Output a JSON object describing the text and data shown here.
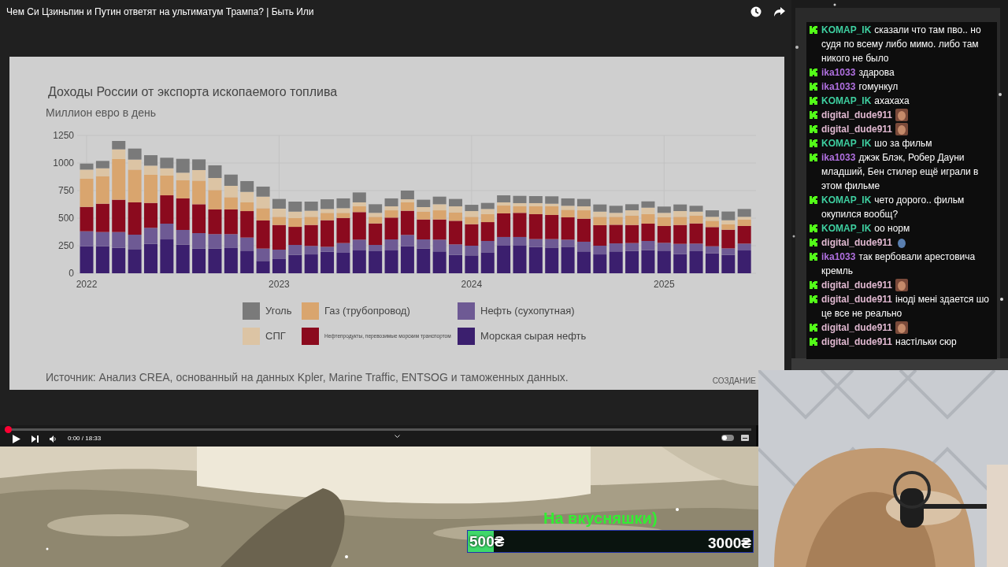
{
  "video": {
    "title": "Чем Си Цзиньпин и Путин ответят на ультиматум Трампа? | Быть Или",
    "slide": {
      "chart_data": {
        "type": "bar",
        "stacked": true,
        "grid": true,
        "title": "Доходы России от экспорта ископаемого топлива",
        "ylabel": "Миллион евро в день",
        "categories": [
          "2022",
          null,
          null,
          null,
          null,
          null,
          null,
          null,
          null,
          null,
          null,
          null,
          "2023",
          null,
          null,
          null,
          null,
          null,
          null,
          null,
          null,
          null,
          null,
          null,
          "2024",
          null,
          null,
          null,
          null,
          null,
          null,
          null,
          null,
          null,
          null,
          null,
          "2025",
          null,
          null,
          null,
          null,
          null
        ],
        "ylim": [
          0,
          1250
        ],
        "yticks": [
          0,
          250,
          500,
          750,
          1000,
          1250
        ],
        "series": [
          {
            "name": "Морская сырая нефть",
            "color": "#3b1f6e",
            "values": [
              245,
              245,
              231,
              219,
              267,
              307,
              260,
              224,
              224,
              229,
              205,
              112,
              129,
              167,
              171,
              195,
              186,
              207,
              200,
              207,
              245,
              224,
              198,
              167,
              162,
              190,
              250,
              250,
              238,
              233,
              240,
              198,
              171,
              198,
              202,
              210,
              205,
              174,
              200,
              181,
              167,
              207
            ]
          },
          {
            "name": "Нефть (сухопутная)",
            "color": "#6e5a94",
            "values": [
              136,
              129,
              143,
              131,
              145,
              143,
              133,
              140,
              131,
              126,
              119,
              112,
              85,
              90,
              77,
              45,
              88,
              98,
              57,
              100,
              103,
              83,
              107,
              95,
              88,
              103,
              79,
              79,
              72,
              77,
              65,
              88,
              79,
              73,
              72,
              83,
              71,
              93,
              69,
              64,
              59,
              62
            ]
          },
          {
            "name": "Нефтепродукты, перевозимые морским транспортом",
            "color": "#8b0a1e",
            "values": [
              221,
              257,
              293,
              293,
              226,
              257,
              286,
              262,
              224,
              224,
              240,
              255,
              224,
              164,
              190,
              241,
              228,
              250,
              195,
              198,
              219,
              181,
              183,
              214,
              195,
              171,
              214,
              219,
              226,
              219,
              202,
              209,
              186,
              169,
              164,
              157,
              153,
              171,
              183,
              174,
              169,
              160
            ]
          },
          {
            "name": "Газ (трубопровод)",
            "color": "#d9a56e",
            "values": [
              255,
              250,
              369,
              297,
              255,
              179,
              166,
              214,
              176,
              111,
              79,
              111,
              74,
              79,
              74,
              67,
              46,
              52,
              60,
              66,
              76,
              72,
              83,
              76,
              67,
              72,
              71,
              59,
              71,
              78,
              69,
              76,
              76,
              72,
              86,
              86,
              78,
              74,
              72,
              57,
              48,
              59
            ]
          },
          {
            "name": "СПГ",
            "color": "#dcc4a4",
            "values": [
              83,
              71,
              88,
              91,
              83,
              66,
              67,
              96,
              109,
              103,
              95,
              105,
              74,
              59,
              55,
              35,
              42,
              36,
              36,
              36,
              28,
              40,
              55,
              55,
              52,
              47,
              29,
              29,
              29,
              24,
              36,
              36,
              47,
              36,
              47,
              59,
              41,
              52,
              35,
              36,
              38,
              24
            ]
          },
          {
            "name": "Уголь",
            "color": "#7a7a7a",
            "values": [
              55,
              67,
              76,
              100,
              95,
              96,
              126,
              97,
              115,
              102,
              98,
              91,
              88,
              91,
              83,
              88,
              89,
              90,
              78,
              72,
              79,
              67,
              69,
              67,
              57,
              55,
              64,
              66,
              64,
              67,
              67,
              67,
              65,
              64,
              55,
              57,
              57,
              60,
              53,
              59,
              79,
              71
            ]
          }
        ]
      },
      "source": "Источник: Анализ CREA, основанный на данных Kpler, Marine Traffic, ENTSOG и таможенных данных.",
      "logo": "СОЗДАНИЕ"
    },
    "player": {
      "progress": {
        "level": 0
      },
      "time": "0:00 / 18:33",
      "autoplay": {
        "on": false
      }
    }
  },
  "chat": {
    "messages": [
      {
        "user": "KOMAP_IK",
        "color": "#3ecfa0",
        "text": "сказали что там пво.. но судя по всему либо мимо. либо там никого не было"
      },
      {
        "user": "ika1033",
        "color": "#b070e0",
        "text": "здарова"
      },
      {
        "user": "ika1033",
        "color": "#b070e0",
        "text": "гомункул"
      },
      {
        "user": "KOMAP_IK",
        "color": "#3ecfa0",
        "text": "ахахаха"
      },
      {
        "user": "digital_dude911",
        "color": "#e0b8d0",
        "kind": "emote"
      },
      {
        "user": "digital_dude911",
        "color": "#e0b8d0",
        "kind": "emote"
      },
      {
        "user": "KOMAP_IK",
        "color": "#3ecfa0",
        "text": "шо за фильм"
      },
      {
        "user": "ika1033",
        "color": "#b070e0",
        "text": "джэк Блэк, Робер Дауни младший, Бен стилер ещё играли в этом фильме"
      },
      {
        "user": "KOMAP_IK",
        "color": "#3ecfa0",
        "text": "чето дорого.. фильм окупился вообщ?"
      },
      {
        "user": "KOMAP_IK",
        "color": "#3ecfa0",
        "text": "оо норм"
      },
      {
        "user": "digital_dude911",
        "color": "#e0b8d0",
        "kind": "figure"
      },
      {
        "user": "ika1033",
        "color": "#b070e0",
        "text": "так вербовали арестовича кремль"
      },
      {
        "user": "digital_dude911",
        "color": "#e0b8d0",
        "kind": "emote"
      },
      {
        "user": "digital_dude911",
        "color": "#e0b8d0",
        "text": "іноді мені здается шо це все не реально"
      },
      {
        "user": "digital_dude911",
        "color": "#e0b8d0",
        "kind": "emote"
      },
      {
        "user": "digital_dude911",
        "color": "#e0b8d0",
        "text": "настільки сюр"
      }
    ]
  },
  "donation_goal": {
    "title": "На вкусняшки)",
    "current": "500₴",
    "target": "3000₴",
    "level": 0.09
  }
}
